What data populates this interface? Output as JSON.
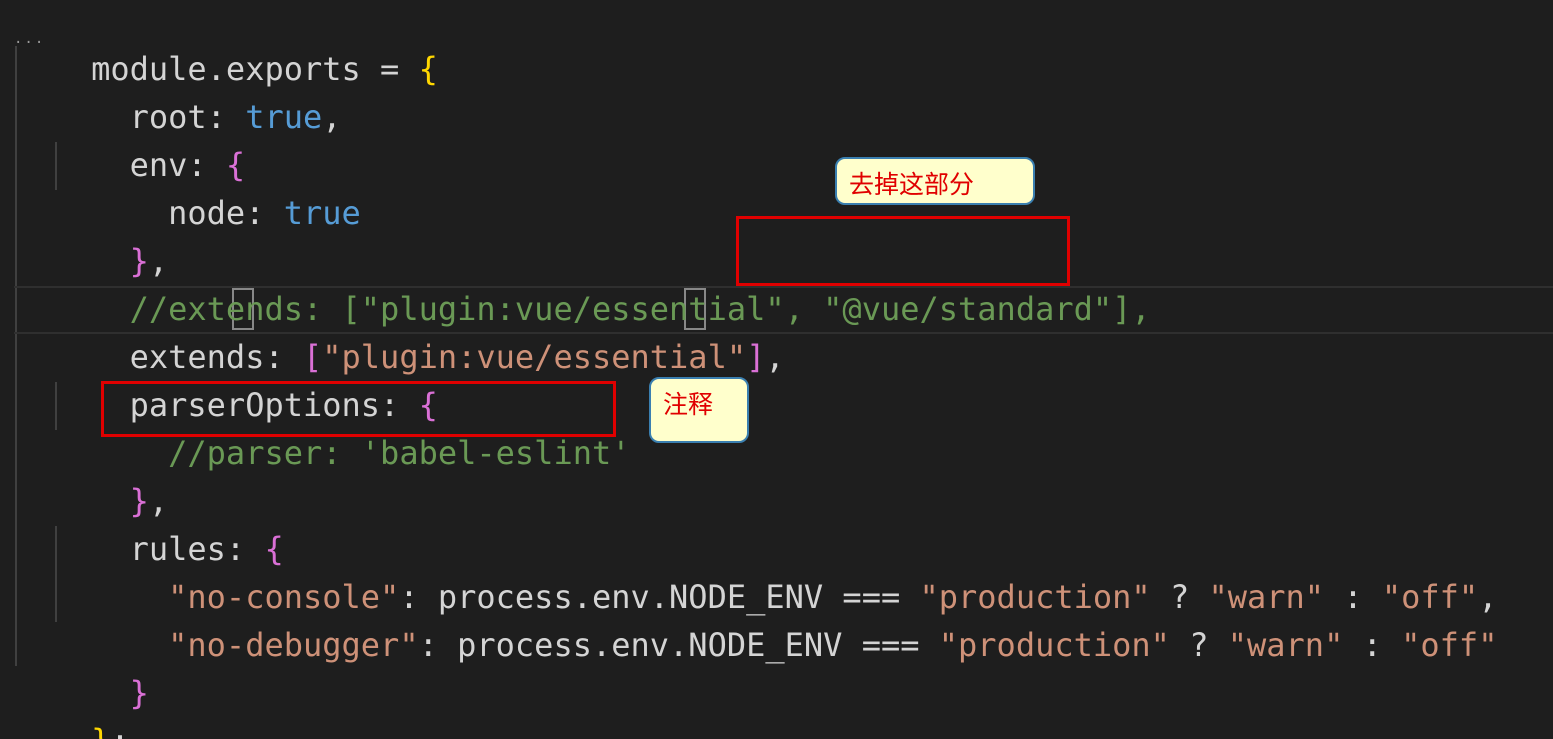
{
  "editor": {
    "theme": {
      "background": "#1e1e1e",
      "text": "#d4d4d4",
      "keyword_bool": "#569cd6",
      "string": "#ce9178",
      "comment": "#6a9955",
      "brace_level1": "#ffd700",
      "brace_level2": "#da70d6",
      "annotation_box": "#e00000",
      "note_background": "#ffffcc"
    },
    "code": {
      "l1": {
        "a": "module.exports = ",
        "b": "{"
      },
      "l2": {
        "a": "  root: ",
        "b": "true",
        "c": ","
      },
      "l3": {
        "a": "  env: ",
        "b": "{"
      },
      "l4": {
        "a": "    node: ",
        "b": "true"
      },
      "l5": {
        "a": "  ",
        "b": "}",
        "c": ","
      },
      "l6": {
        "a": "  ",
        "b": "//extends: [\"plugin:vue/essential\", \"@vue/standard\"],",
        "c": ""
      },
      "l7": {
        "a": "  extends: ",
        "b": "[",
        "c": "\"plugin:vue/essential\"",
        "d": "]",
        "e": ","
      },
      "l8": {
        "a": "  parserOptions: ",
        "b": "{"
      },
      "l9": {
        "a": "    ",
        "b": "//parser: 'babel-eslint'"
      },
      "l10": {
        "a": "  ",
        "b": "}",
        "c": ","
      },
      "l11": {
        "a": "  rules: ",
        "b": "{"
      },
      "l12": {
        "a": "    ",
        "b": "\"no-console\"",
        "c": ": process.env.NODE_ENV === ",
        "d": "\"production\"",
        "e": " ? ",
        "f": "\"warn\"",
        "g": " : ",
        "h": "\"off\"",
        "i": ","
      },
      "l13": {
        "a": "    ",
        "b": "\"no-debugger\"",
        "c": ": process.env.NODE_ENV === ",
        "d": "\"production\"",
        "e": " ? ",
        "f": "\"warn\"",
        "g": " : ",
        "h": "\"off\""
      },
      "l14": {
        "a": "  ",
        "b": "}"
      },
      "l15": {
        "a": "",
        "b": "}",
        "c": ";"
      }
    },
    "fold_marker": "...",
    "annotations": {
      "remove_note": "去掉这部分",
      "comment_note": "注释"
    }
  }
}
